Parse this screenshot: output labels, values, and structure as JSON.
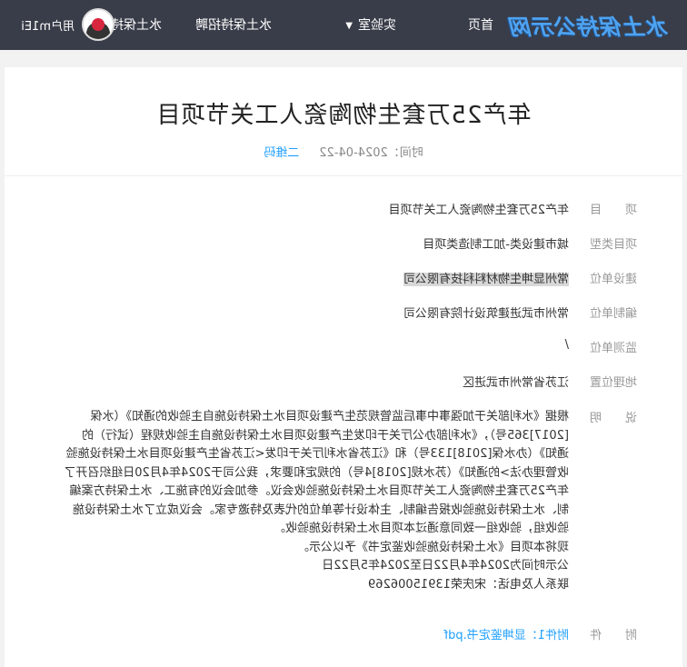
{
  "header": {
    "logo": "水土保持公示网",
    "nav": {
      "home": "首页",
      "lab": "实验室",
      "recruit": "水土保持招聘",
      "library": "水土保持文库"
    },
    "user_name": "用户m1Ei"
  },
  "article": {
    "title": "年产25万套生物陶瓷人工关节项目",
    "time_label": "时间：2024-04-22",
    "edit_link": "二维码",
    "fields": [
      {
        "label": "项　　目",
        "value": "年产25万套生物陶瓷人工关节项目"
      },
      {
        "label": "项目类型",
        "value": "城市建设类-加工制造类项目"
      },
      {
        "label": "建设单位",
        "value": "常州显坤生物材料科技有限公司"
      },
      {
        "label": "编制单位",
        "value": "常州市武进建筑设计院有限公司"
      },
      {
        "label": "监测单位",
        "value": "/"
      },
      {
        "label": "地理位置",
        "value": "江苏省常州市武进区"
      }
    ],
    "description_label": "说　　明",
    "description_lines": [
      "根据《水利部关于加强事中事后监管规范生产建设项目水土保持设施自主验收的通知》（水保",
      "[2017]365号），《水利部办公厅关于印发生产建设项目水土保持设施自主验收规程（试行）的",
      "通知》（办水保[2018]133号）和《江苏省水利厅关于印发<江苏省生产建设项目水土保持设施验",
      "收管理办法>的通知》（苏水规[2018]4号）的规定和要求，我公司于2024年4月20日组织召开了",
      "年产25万套生物陶瓷人工关节项目水土保持设施验收会议。参加会议的有施工、水土保持方案编",
      "制、水土保持设施验收报告编制、主体设计等单位的代表及特邀专家。会议成立了水土保持设施",
      "验收组，验收组一致同意通过本项目水土保持设施验收。",
      "现将本项目《水土保持设施验收鉴定书》予以公示。",
      "公示时间为2024年4月22日至2024年5月22日",
      "联系人及电话：宋庆荣13915006269"
    ],
    "attachment_label": "附　　件",
    "attachment": "附件1：显坤鉴定书.pdf"
  }
}
